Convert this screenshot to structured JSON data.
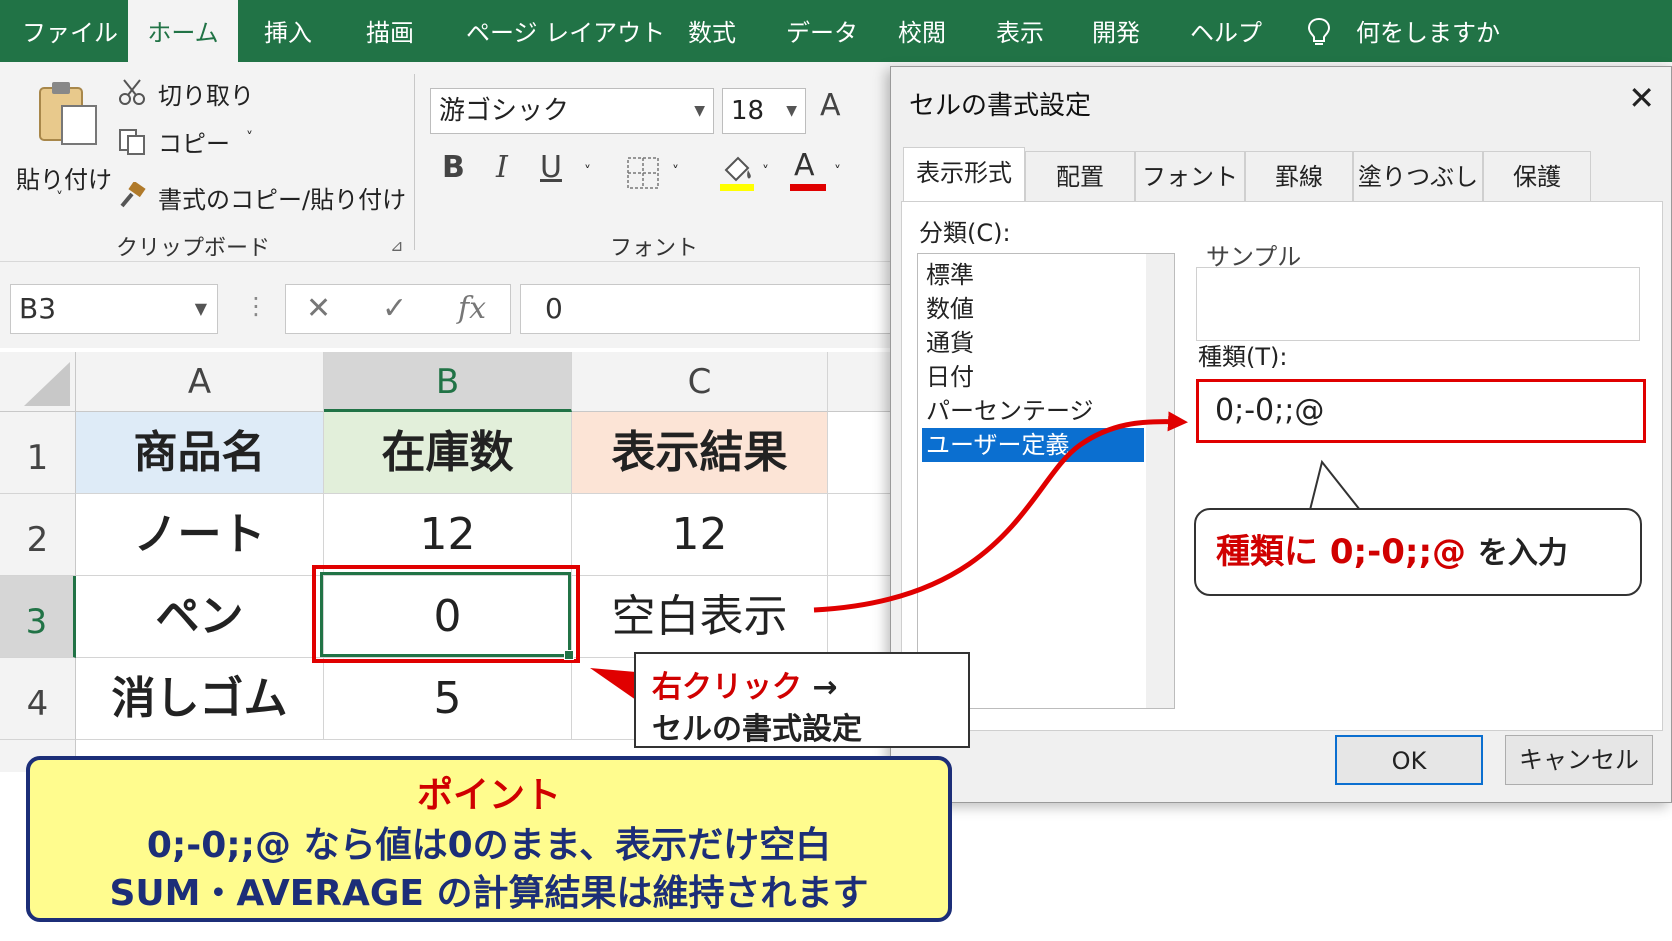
{
  "menu": {
    "tabs": [
      {
        "label": "ファイル"
      },
      {
        "label": "ホーム"
      },
      {
        "label": "挿入"
      },
      {
        "label": "描画"
      },
      {
        "label": "ページ レイアウト"
      },
      {
        "label": "数式"
      },
      {
        "label": "データ"
      },
      {
        "label": "校閲"
      },
      {
        "label": "表示"
      },
      {
        "label": "開発"
      },
      {
        "label": "ヘルプ"
      }
    ],
    "active_tab": "ホーム",
    "tell_me": "何をしますか",
    "tell_me_icon": "lightbulb-icon"
  },
  "ribbon": {
    "clipboard": {
      "paste": "貼り付け",
      "cut": "切り取り",
      "copy": "コピー",
      "format_painter": "書式のコピー/貼り付け",
      "group_label": "クリップボード"
    },
    "font": {
      "font_name": "游ゴシック",
      "font_size": "18",
      "grow_font": "A",
      "bold": "B",
      "italic": "I",
      "underline": "U",
      "font_color_glyph": "A",
      "group_label": "フォント",
      "highlight_color": "#ffff00",
      "font_color": "#e00000"
    }
  },
  "formula_bar": {
    "name_box": "B3",
    "formula": "0"
  },
  "sheet": {
    "columns": [
      "A",
      "B",
      "C"
    ],
    "selected_column": "B",
    "rows": [
      "1",
      "2",
      "3",
      "4"
    ],
    "selected_row": "3",
    "header_row": [
      "商品名",
      "在庫数",
      "表示結果"
    ],
    "data": [
      [
        "ノート",
        "12",
        "12"
      ],
      [
        "ペン",
        "0",
        "空白表示"
      ],
      [
        "消しゴム",
        "5",
        ""
      ]
    ],
    "header_colors": [
      "#deebf7",
      "#e2efda",
      "#fce4d6"
    ],
    "accent": "#217346"
  },
  "dialog": {
    "title": "セルの書式設定",
    "tabs": [
      "表示形式",
      "配置",
      "フォント",
      "罫線",
      "塗りつぶし",
      "保護"
    ],
    "active_tab": "表示形式",
    "category_label": "分類(C):",
    "categories": [
      "標準",
      "数値",
      "通貨",
      "日付",
      "パーセンテージ",
      "ユーザー定義"
    ],
    "selected_category": "ユーザー定義",
    "sample_label": "サンプル",
    "type_label": "種類(T):",
    "type_value": "0;-0;;@",
    "ok": "OK",
    "cancel": "キャンセル"
  },
  "annotations": {
    "right_click": "右クリック",
    "arrow": "→",
    "menu_path": "セルの書式設定",
    "type_prefix": "種類に",
    "type_code": "0;-0;;@",
    "type_suffix": "を入力",
    "point_title": "ポイント",
    "point_line1": "0;-0;;@ なら値は0のまま、表示だけ空白",
    "point_line2": "SUM・AVERAGE の計算結果は維持されます",
    "highlight_color": "#e00000"
  }
}
